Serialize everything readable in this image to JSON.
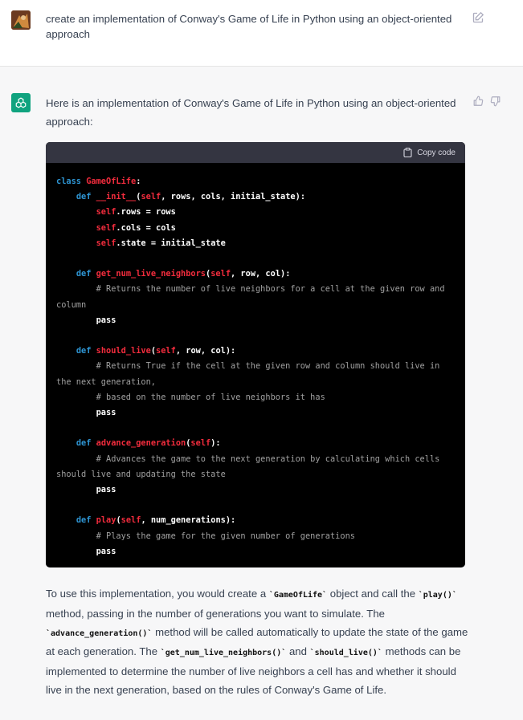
{
  "user_message": {
    "text": "create an implementation of Conway's Game of Life in Python using an object-oriented approach"
  },
  "assistant_message": {
    "intro": "Here is an implementation of Conway's Game of Life in Python using an object-oriented approach:",
    "code_block": {
      "copy_label": "Copy code",
      "language": "python",
      "lines": [
        {
          "indent": "",
          "parts": [
            {
              "t": "kw",
              "v": "class "
            },
            {
              "t": "fn",
              "v": "GameOfLife"
            },
            {
              "t": "tx",
              "v": ":"
            }
          ]
        },
        {
          "indent": "    ",
          "parts": [
            {
              "t": "kw",
              "v": "def "
            },
            {
              "t": "fn",
              "v": "__init__"
            },
            {
              "t": "tx",
              "v": "("
            },
            {
              "t": "fn",
              "v": "self"
            },
            {
              "t": "tx",
              "v": ", rows, cols, initial_state):"
            }
          ]
        },
        {
          "indent": "        ",
          "parts": [
            {
              "t": "fn",
              "v": "self"
            },
            {
              "t": "tx",
              "v": ".rows = rows"
            }
          ]
        },
        {
          "indent": "        ",
          "parts": [
            {
              "t": "fn",
              "v": "self"
            },
            {
              "t": "tx",
              "v": ".cols = cols"
            }
          ]
        },
        {
          "indent": "        ",
          "parts": [
            {
              "t": "fn",
              "v": "self"
            },
            {
              "t": "tx",
              "v": ".state = initial_state"
            }
          ]
        },
        {
          "indent": "",
          "parts": []
        },
        {
          "indent": "    ",
          "parts": [
            {
              "t": "kw",
              "v": "def "
            },
            {
              "t": "fn",
              "v": "get_num_live_neighbors"
            },
            {
              "t": "tx",
              "v": "("
            },
            {
              "t": "fn",
              "v": "self"
            },
            {
              "t": "tx",
              "v": ", row, col):"
            }
          ]
        },
        {
          "indent": "        ",
          "parts": [
            {
              "t": "cm",
              "v": "# Returns the number of live neighbors for a cell at the given row and"
            }
          ]
        },
        {
          "indent": "",
          "parts": [
            {
              "t": "cm",
              "v": "column"
            }
          ]
        },
        {
          "indent": "        ",
          "parts": [
            {
              "t": "tx",
              "v": "pass"
            }
          ]
        },
        {
          "indent": "",
          "parts": []
        },
        {
          "indent": "    ",
          "parts": [
            {
              "t": "kw",
              "v": "def "
            },
            {
              "t": "fn",
              "v": "should_live"
            },
            {
              "t": "tx",
              "v": "("
            },
            {
              "t": "fn",
              "v": "self"
            },
            {
              "t": "tx",
              "v": ", row, col):"
            }
          ]
        },
        {
          "indent": "        ",
          "parts": [
            {
              "t": "cm",
              "v": "# Returns True if the cell at the given row and column should live in"
            }
          ]
        },
        {
          "indent": "",
          "parts": [
            {
              "t": "cm",
              "v": "the next generation,"
            }
          ]
        },
        {
          "indent": "        ",
          "parts": [
            {
              "t": "cm",
              "v": "# based on the number of live neighbors it has"
            }
          ]
        },
        {
          "indent": "        ",
          "parts": [
            {
              "t": "tx",
              "v": "pass"
            }
          ]
        },
        {
          "indent": "",
          "parts": []
        },
        {
          "indent": "    ",
          "parts": [
            {
              "t": "kw",
              "v": "def "
            },
            {
              "t": "fn",
              "v": "advance_generation"
            },
            {
              "t": "tx",
              "v": "("
            },
            {
              "t": "fn",
              "v": "self"
            },
            {
              "t": "tx",
              "v": "):"
            }
          ]
        },
        {
          "indent": "        ",
          "parts": [
            {
              "t": "cm",
              "v": "# Advances the game to the next generation by calculating which cells"
            }
          ]
        },
        {
          "indent": "",
          "parts": [
            {
              "t": "cm",
              "v": "should live and updating the state"
            }
          ]
        },
        {
          "indent": "        ",
          "parts": [
            {
              "t": "tx",
              "v": "pass"
            }
          ]
        },
        {
          "indent": "",
          "parts": []
        },
        {
          "indent": "    ",
          "parts": [
            {
              "t": "kw",
              "v": "def "
            },
            {
              "t": "fn",
              "v": "play"
            },
            {
              "t": "tx",
              "v": "("
            },
            {
              "t": "fn",
              "v": "self"
            },
            {
              "t": "tx",
              "v": ", num_generations):"
            }
          ]
        },
        {
          "indent": "        ",
          "parts": [
            {
              "t": "cm",
              "v": "# Plays the game for the given number of generations"
            }
          ]
        },
        {
          "indent": "        ",
          "parts": [
            {
              "t": "tx",
              "v": "pass"
            }
          ]
        }
      ]
    },
    "outro": [
      {
        "t": "tx",
        "v": "To use this implementation, you would create a "
      },
      {
        "t": "code",
        "v": "`GameOfLife`"
      },
      {
        "t": "tx",
        "v": " object and call the "
      },
      {
        "t": "code",
        "v": "`play()`"
      },
      {
        "t": "tx",
        "v": " method, passing in the number of generations you want to simulate. The "
      },
      {
        "t": "code",
        "v": "`advance_generation()`"
      },
      {
        "t": "tx",
        "v": " method will be called automatically to update the state of the game at each generation. The "
      },
      {
        "t": "code",
        "v": "`get_num_live_neighbors()`"
      },
      {
        "t": "tx",
        "v": " and "
      },
      {
        "t": "code",
        "v": "`should_live()`"
      },
      {
        "t": "tx",
        "v": " methods can be implemented to determine the number of live neighbors a cell has and whether it should live in the next generation, based on the rules of Conway's Game of Life."
      }
    ]
  },
  "icons": {
    "edit": "edit-icon",
    "copy": "clipboard-icon",
    "thumbs_up": "thumbs-up-icon",
    "thumbs_down": "thumbs-down-icon",
    "assistant_logo": "openai-logo-icon"
  },
  "colors": {
    "assistant_avatar_bg": "#10a37f",
    "code_bg": "#000000",
    "code_header_bg": "#343541",
    "keyword": "#2e95d3",
    "function_name": "#f22c3d",
    "comment": "#a0a0a0"
  }
}
